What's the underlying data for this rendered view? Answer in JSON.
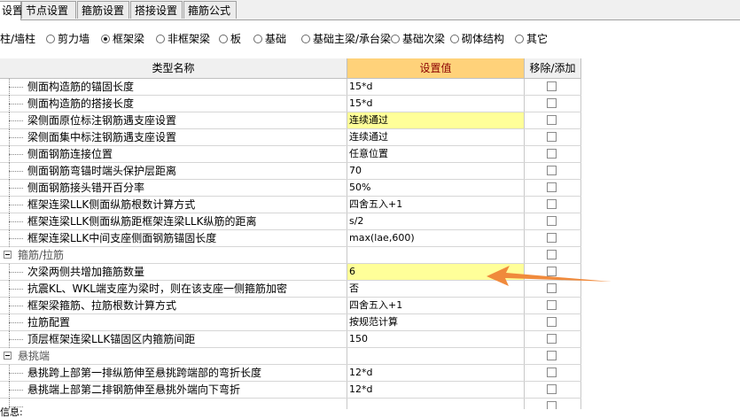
{
  "tabs": [
    "设置",
    "节点设置",
    "箍筋设置",
    "搭接设置",
    "箍筋公式"
  ],
  "radios": [
    {
      "label": "柱/墙柱",
      "checked": false,
      "show_dot": false
    },
    {
      "label": "剪力墙",
      "checked": false,
      "show_dot": true
    },
    {
      "label": "框架梁",
      "checked": true,
      "show_dot": true
    },
    {
      "label": "非框架梁",
      "checked": false,
      "show_dot": true
    },
    {
      "label": "板",
      "checked": false,
      "show_dot": true
    },
    {
      "label": "基础",
      "checked": false,
      "show_dot": true
    },
    {
      "label": "基础主梁/承台梁",
      "checked": false,
      "show_dot": true
    },
    {
      "label": "基础次梁",
      "checked": false,
      "show_dot": true
    },
    {
      "label": "砌体结构",
      "checked": false,
      "show_dot": true
    },
    {
      "label": "其它",
      "checked": false,
      "show_dot": true
    }
  ],
  "table": {
    "headers": {
      "name": "类型名称",
      "value": "设置值",
      "remove": "移除/添加"
    },
    "rows": [
      {
        "type": "item",
        "name": "侧面构造筋的锚固长度",
        "value": "15*d",
        "highlight": false
      },
      {
        "type": "item",
        "name": "侧面构造筋的搭接长度",
        "value": "15*d",
        "highlight": false
      },
      {
        "type": "item",
        "name": "梁侧面原位标注钢筋遇支座设置",
        "value": "连续通过",
        "highlight": true
      },
      {
        "type": "item",
        "name": "梁侧面集中标注钢筋遇支座设置",
        "value": "连续通过",
        "highlight": false
      },
      {
        "type": "item",
        "name": "侧面钢筋连接位置",
        "value": "任意位置",
        "highlight": false
      },
      {
        "type": "item",
        "name": "侧面钢筋弯锚时端头保护层距离",
        "value": "70",
        "highlight": false
      },
      {
        "type": "item",
        "name": "侧面钢筋接头错开百分率",
        "value": "50%",
        "highlight": false
      },
      {
        "type": "item",
        "name": "框架连梁LLK侧面纵筋根数计算方式",
        "value": "四舍五入+1",
        "highlight": false
      },
      {
        "type": "item",
        "name": "框架连梁LLK侧面纵筋距框架连梁LLK纵筋的距离",
        "value": "s/2",
        "highlight": false
      },
      {
        "type": "item",
        "name": "框架连梁LLK中间支座侧面钢筋锚固长度",
        "value": "max(lae,600)",
        "highlight": false
      },
      {
        "type": "group",
        "name": "箍筋/拉筋"
      },
      {
        "type": "item",
        "name": "次梁两侧共增加箍筋数量",
        "value": "6",
        "highlight": true
      },
      {
        "type": "item",
        "name": "抗震KL、WKL端支座为梁时，则在该支座一侧箍筋加密",
        "value": "否",
        "highlight": false
      },
      {
        "type": "item",
        "name": "框架梁箍筋、拉筋根数计算方式",
        "value": "四舍五入+1",
        "highlight": false
      },
      {
        "type": "item",
        "name": "拉筋配置",
        "value": "按规范计算",
        "highlight": false
      },
      {
        "type": "item",
        "name": "顶层框架连梁LLK锚固区内箍筋间距",
        "value": "150",
        "highlight": false
      },
      {
        "type": "group",
        "name": "悬挑端"
      },
      {
        "type": "item",
        "name": "悬挑跨上部第一排纵筋伸至悬挑跨端部的弯折长度",
        "value": "12*d",
        "highlight": false
      },
      {
        "type": "item",
        "name": "悬挑端上部第二排钢筋伸至悬挑外端向下弯折",
        "value": "12*d",
        "highlight": false
      },
      {
        "type": "item",
        "name": "",
        "value": "",
        "highlight": false
      }
    ]
  },
  "status": {
    "label": "信息:"
  },
  "colors": {
    "header_value_bg": "#ffd27a",
    "header_value_text": "#8b0000",
    "highlight": "#ffff99",
    "arrow": "#f08a3c"
  }
}
